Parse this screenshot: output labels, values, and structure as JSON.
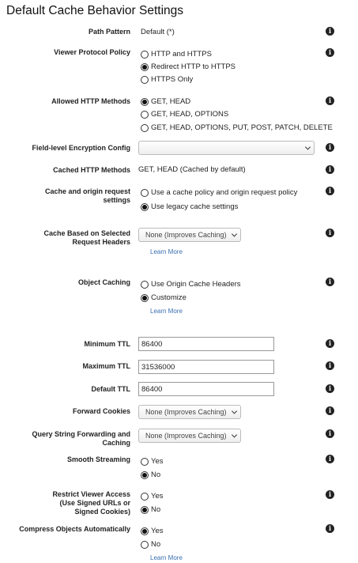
{
  "page": {
    "title": "Default Cache Behavior Settings"
  },
  "path_pattern": {
    "label": "Path Pattern",
    "value": "Default (*)"
  },
  "viewer_protocol_policy": {
    "label": "Viewer Protocol Policy",
    "options": [
      "HTTP and HTTPS",
      "Redirect HTTP to HTTPS",
      "HTTPS Only"
    ],
    "selected": "Redirect HTTP to HTTPS"
  },
  "allowed_http_methods": {
    "label": "Allowed HTTP Methods",
    "options": [
      "GET, HEAD",
      "GET, HEAD, OPTIONS",
      "GET, HEAD, OPTIONS, PUT, POST, PATCH, DELETE"
    ],
    "selected": "GET, HEAD"
  },
  "field_level_encryption": {
    "label": "Field-level Encryption Config",
    "value": ""
  },
  "cached_http_methods": {
    "label": "Cached HTTP Methods",
    "value": "GET, HEAD (Cached by default)"
  },
  "cache_and_origin_request": {
    "label_1": "Cache and origin request",
    "label_2": "settings",
    "options": [
      "Use a cache policy and origin request policy",
      "Use legacy cache settings"
    ],
    "selected": "Use legacy cache settings"
  },
  "cache_based_on_headers": {
    "label_1": "Cache Based on Selected",
    "label_2": "Request Headers",
    "value": "None (Improves Caching)",
    "link": "Learn More"
  },
  "object_caching": {
    "label": "Object Caching",
    "options": [
      "Use Origin Cache Headers",
      "Customize"
    ],
    "selected": "Customize",
    "link": "Learn More"
  },
  "minimum_ttl": {
    "label": "Minimum TTL",
    "value": "86400"
  },
  "maximum_ttl": {
    "label": "Maximum TTL",
    "value": "31536000"
  },
  "default_ttl": {
    "label": "Default TTL",
    "value": "86400"
  },
  "forward_cookies": {
    "label": "Forward Cookies",
    "value": "None (Improves Caching)"
  },
  "query_string_forwarding": {
    "label_1": "Query String Forwarding and",
    "label_2": "Caching",
    "value": "None (Improves Caching)"
  },
  "smooth_streaming": {
    "label": "Smooth Streaming",
    "options": [
      "Yes",
      "No"
    ],
    "selected": "No"
  },
  "restrict_viewer_access": {
    "label_1": "Restrict Viewer Access",
    "label_2": "(Use Signed URLs or",
    "label_3": "Signed Cookies)",
    "options": [
      "Yes",
      "No"
    ],
    "selected": "No"
  },
  "compress_objects": {
    "label": "Compress Objects Automatically",
    "options": [
      "Yes",
      "No"
    ],
    "selected": "Yes",
    "link": "Learn More"
  },
  "icons": {
    "info": "info-icon",
    "dropdown": "chevron-down-icon",
    "radio": "radio-button"
  }
}
